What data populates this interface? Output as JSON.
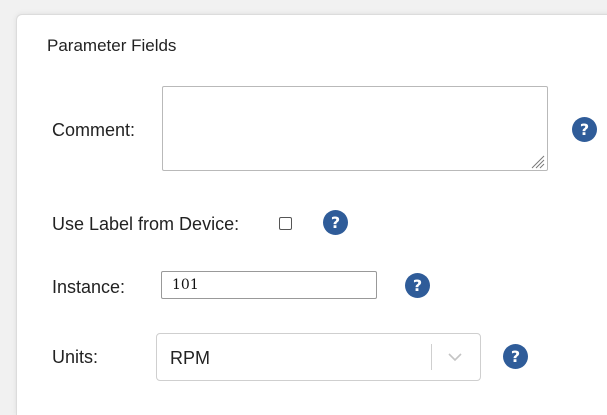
{
  "section": {
    "title": "Parameter Fields"
  },
  "fields": {
    "comment": {
      "label": "Comment:",
      "value": ""
    },
    "use_label": {
      "label": "Use Label from Device:",
      "checked": false
    },
    "instance": {
      "label": "Instance:",
      "value": "101"
    },
    "units": {
      "label": "Units:",
      "selected": "RPM"
    }
  },
  "help_glyph": "?",
  "colors": {
    "help_icon": "#2f5c99",
    "border": "#b9b9b9",
    "background": "#ffffff"
  },
  "icons": {
    "help": "question-circle-icon",
    "select": "chevron-down-icon",
    "resize": "resize-grip-icon"
  }
}
